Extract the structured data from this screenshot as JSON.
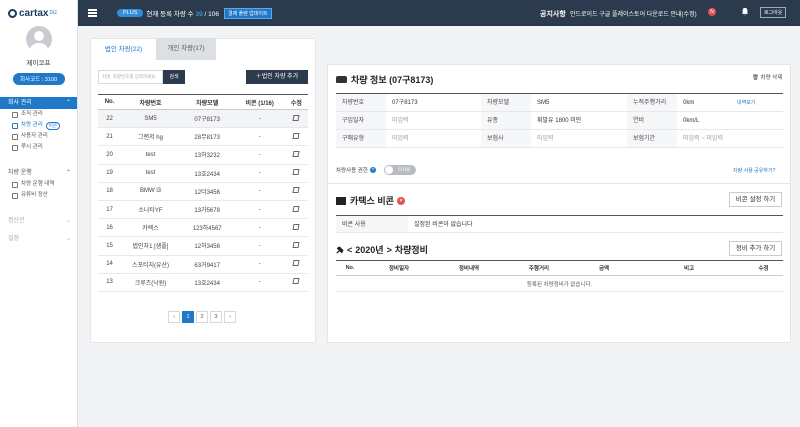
{
  "app": {
    "logo": "cartax",
    "logo_suffix": "biz"
  },
  "profile": {
    "company": "제이코프",
    "code_label": "회사코드 : 3100"
  },
  "sidebar": {
    "sections": [
      {
        "label": "회사 관리",
        "items": [
          {
            "label": "조직 관리"
          },
          {
            "label": "차량 관리",
            "tag": "비콘"
          },
          {
            "label": "사용자 관리"
          },
          {
            "label": "루시 관리"
          }
        ]
      },
      {
        "label": "차량 운행",
        "items": [
          {
            "label": "차량 운행 내역"
          },
          {
            "label": "유류비 정산"
          }
        ]
      },
      {
        "label": "정산관"
      },
      {
        "label": "설정"
      }
    ]
  },
  "topbar": {
    "plan": "PLUS",
    "reg_label": "현재 등록 차량 수",
    "reg_current": "39",
    "reg_total": "/ 106",
    "pay_button": "결제 플랜 업데이트",
    "notice_label": "공지사항",
    "notice_text": "안드로이드 구글 플레이스토어 다운로드 안내(수정)",
    "notice_badge": "N",
    "logout": "로그아웃"
  },
  "tabs": [
    {
      "label": "법인 차량(22)"
    },
    {
      "label": "개인 차량(17)"
    }
  ],
  "search": {
    "placeholder": "차명, 차량번호를 입력하세요",
    "button": "검색"
  },
  "add_car_button": "법인 차량 추가",
  "car_table": {
    "headers": [
      "No.",
      "차량번호",
      "차량모델",
      "비콘 (1/16)",
      "수정"
    ],
    "rows": [
      {
        "no": "22",
        "number": "SM5",
        "model": "07구8173",
        "beacon": "-"
      },
      {
        "no": "21",
        "number": "그랜저 hg",
        "model": "28무8173",
        "beacon": "-"
      },
      {
        "no": "20",
        "number": "test",
        "model": "13허3232",
        "beacon": "-"
      },
      {
        "no": "19",
        "number": "test",
        "model": "13호2434",
        "beacon": "-"
      },
      {
        "no": "18",
        "number": "BMW i3",
        "model": "12더3456",
        "beacon": "-"
      },
      {
        "no": "17",
        "number": "소나타YF",
        "model": "13가5678",
        "beacon": "-"
      },
      {
        "no": "16",
        "number": "카렉스",
        "model": "123하4567",
        "beacon": "-"
      },
      {
        "no": "15",
        "number": "법인차1 [샘플]",
        "model": "12허3456",
        "beacon": "-"
      },
      {
        "no": "14",
        "number": "스포티지(유산)",
        "model": "63거9417",
        "beacon": "-"
      },
      {
        "no": "13",
        "number": "크루즈(낙원)",
        "model": "13호2434",
        "beacon": "-"
      }
    ]
  },
  "pager": {
    "prev": "‹",
    "pages": [
      "1",
      "2",
      "3"
    ],
    "next": "›"
  },
  "car_info": {
    "title": "차량 정보 (07구8173)",
    "delete": "차량 삭제",
    "rows": [
      [
        {
          "label": "차량번호",
          "value": "07구8173"
        },
        {
          "label": "차량모델",
          "value": "SM5"
        },
        {
          "label": "누적주행거리",
          "value": "0km",
          "link": "내역보기"
        }
      ],
      [
        {
          "label": "구입일자",
          "value": "미입력",
          "dim": true
        },
        {
          "label": "유종",
          "value": "휘발유 1800 미만"
        },
        {
          "label": "연비",
          "value": "0km/L"
        }
      ],
      [
        {
          "label": "구매유형",
          "value": "미입력",
          "dim": true
        },
        {
          "label": "보험사",
          "value": "미입력",
          "dim": true
        },
        {
          "label": "보험기간",
          "value": "미입력 ~ 미입력",
          "dim": true
        }
      ]
    ],
    "usage_label": "차량사용 권한",
    "usage_toggle": "미사용",
    "share_link": "차량 사용 공유하기?"
  },
  "beacon": {
    "title": "카택스 비콘",
    "setup_button": "비콘 설정 하기",
    "label": "비콘 사용",
    "value": "설정된 비콘이 없습니다"
  },
  "maintenance": {
    "prev": "<",
    "year": "2020년",
    "next": ">",
    "title": "차량정비",
    "add_button": "정비 추가 하기",
    "headers": [
      "No.",
      "정비일자",
      "정비내역",
      "주행거리",
      "금액",
      "비고",
      "수정"
    ],
    "empty": "등록된 차량정비가 없습니다."
  }
}
